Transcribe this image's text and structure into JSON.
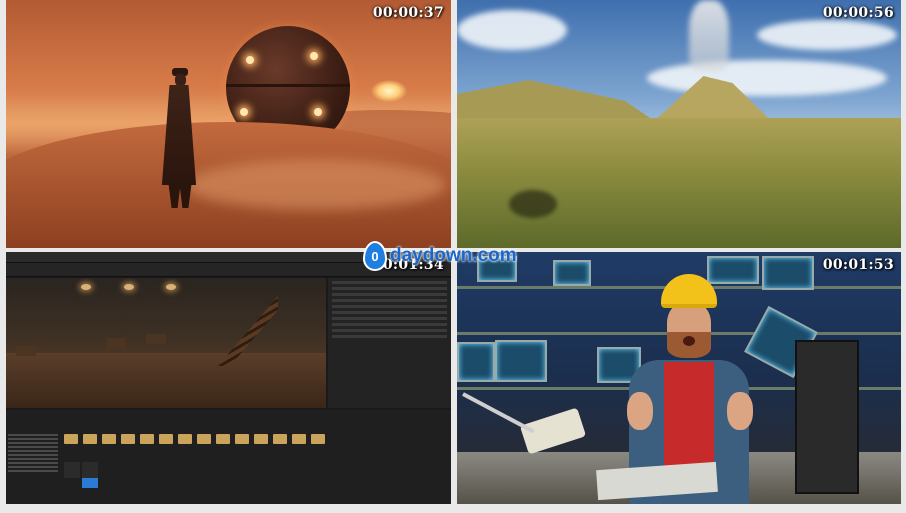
{
  "panels": [
    {
      "id": "desert-scene",
      "timestamp": "00:00:37"
    },
    {
      "id": "terrain-scene",
      "timestamp": "00:00:56"
    },
    {
      "id": "editor-scene",
      "timestamp": "00:01:34"
    },
    {
      "id": "instructor-scene",
      "timestamp": "00:01:53"
    }
  ],
  "watermark": {
    "icon_text": "0",
    "text": "daydown.com"
  },
  "colors": {
    "background": "#e9e9e9",
    "timestamp": "#ffffff",
    "watermark": "#1b66c9"
  }
}
